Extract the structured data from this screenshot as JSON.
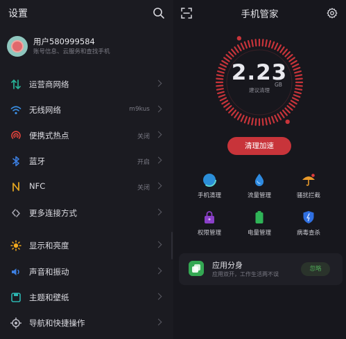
{
  "settings": {
    "title": "设置",
    "profile": {
      "name": "用户580999584",
      "subtitle": "账号信息、云服务和查找手机"
    },
    "items": [
      {
        "label": "运营商网络",
        "value": "",
        "icon": "cellular-icon",
        "color": "#27b398"
      },
      {
        "label": "无线网络",
        "value": "m9kus",
        "icon": "wifi-icon",
        "color": "#3a8de2"
      },
      {
        "label": "便携式热点",
        "value": "关闭",
        "icon": "hotspot-icon",
        "color": "#e2443c"
      },
      {
        "label": "蓝牙",
        "value": "开启",
        "icon": "bluetooth-icon",
        "color": "#3b7ee0"
      },
      {
        "label": "NFC",
        "value": "关闭",
        "icon": "nfc-icon",
        "color": "#e0a320"
      },
      {
        "label": "更多连接方式",
        "value": "",
        "icon": "link-icon",
        "color": "#a8a8b2"
      },
      {
        "label": "显示和亮度",
        "value": "",
        "icon": "brightness-icon",
        "color": "#f0a81e"
      },
      {
        "label": "声音和振动",
        "value": "",
        "icon": "sound-icon",
        "color": "#3d7fe0"
      },
      {
        "label": "主题和壁纸",
        "value": "",
        "icon": "theme-icon",
        "color": "#2cb5b0"
      },
      {
        "label": "导航和快捷操作",
        "value": "",
        "icon": "navigation-icon",
        "color": "#b8b8c2"
      }
    ]
  },
  "manager": {
    "title": "手机管家",
    "gauge": {
      "value": "2.23",
      "unit": "GB",
      "subtitle": "建议清理"
    },
    "clean_button": "清理加速",
    "tools": [
      {
        "label": "手机清理",
        "icon": "phone-clean-icon"
      },
      {
        "label": "流量管理",
        "icon": "data-usage-icon"
      },
      {
        "label": "骚扰拦截",
        "icon": "spam-block-icon"
      },
      {
        "label": "权限管理",
        "icon": "permission-icon"
      },
      {
        "label": "电量管理",
        "icon": "battery-icon"
      },
      {
        "label": "病毒查杀",
        "icon": "antivirus-icon"
      }
    ],
    "app_clone": {
      "title": "应用分身",
      "subtitle": "应用双开，工作生活两不误",
      "button": "忽略"
    }
  },
  "colors": {
    "accent_red": "#c8343a",
    "clone_green": "#34a853"
  }
}
